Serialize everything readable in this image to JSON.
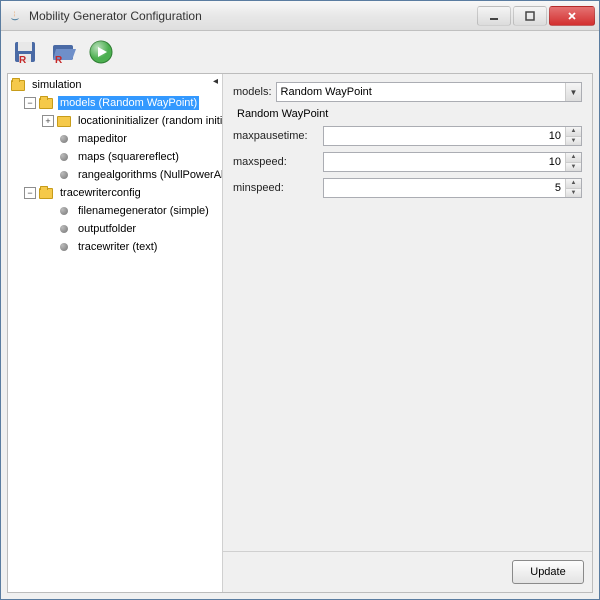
{
  "window": {
    "title": "Mobility Generator Configuration"
  },
  "toolbar": {
    "save_tooltip": "Save",
    "open_tooltip": "Open",
    "run_tooltip": "Run"
  },
  "tree": {
    "root": "simulation",
    "models": "models (Random WayPoint)",
    "locationinitializer": "locationinitializer (random initializer)",
    "mapeditor": "mapeditor",
    "maps": "maps (squarereflect)",
    "rangealgorithms": "rangealgorithms (NullPowerAlgorithm)",
    "tracewriterconfig": "tracewriterconfig",
    "filenamegenerator": "filenamegenerator (simple)",
    "outputfolder": "outputfolder",
    "tracewriter": "tracewriter (text)"
  },
  "form": {
    "models_label": "models:",
    "models_value": "Random WayPoint",
    "subheading": "Random WayPoint",
    "maxpausetime_label": "maxpausetime:",
    "maxpausetime_value": "10",
    "maxspeed_label": "maxspeed:",
    "maxspeed_value": "10",
    "minspeed_label": "minspeed:",
    "minspeed_value": "5"
  },
  "buttons": {
    "update": "Update"
  }
}
